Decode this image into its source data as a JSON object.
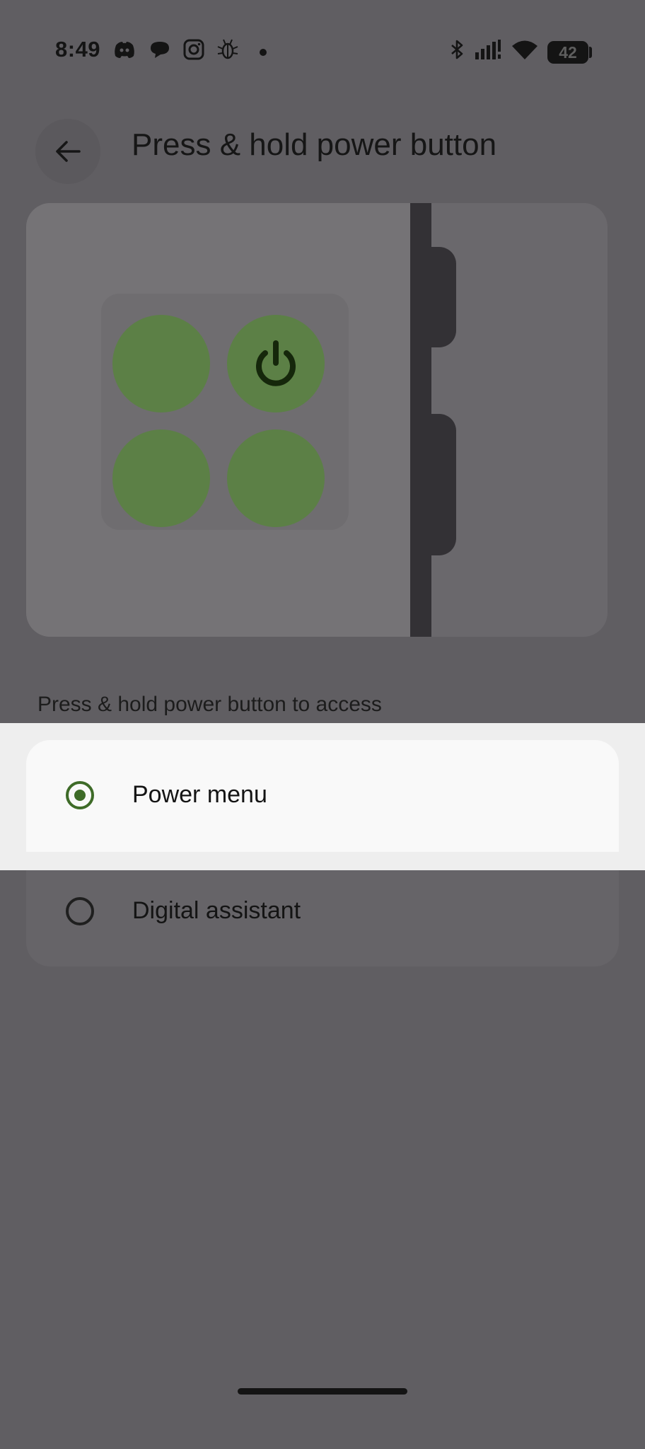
{
  "status_bar": {
    "time": "8:49",
    "battery_level": "42",
    "icons": [
      "discord-icon",
      "message-bubble-icon",
      "instagram-icon",
      "bug-icon",
      "dot-icon",
      "bluetooth-icon",
      "cellular-signal-icon",
      "wifi-icon",
      "battery-icon"
    ]
  },
  "header": {
    "back_icon": "back-arrow-icon",
    "title": "Press & hold power button"
  },
  "illustration": {
    "accent_color": "#5c8046",
    "icon": "power-icon"
  },
  "section": {
    "label": "Press & hold power button to access"
  },
  "options": [
    {
      "label": "Power menu",
      "selected": true
    },
    {
      "label": "Digital assistant",
      "selected": false
    }
  ],
  "colors": {
    "scrim": "#605e62",
    "selected_radio": "#3e6b28",
    "highlight": "#eeeeee"
  }
}
